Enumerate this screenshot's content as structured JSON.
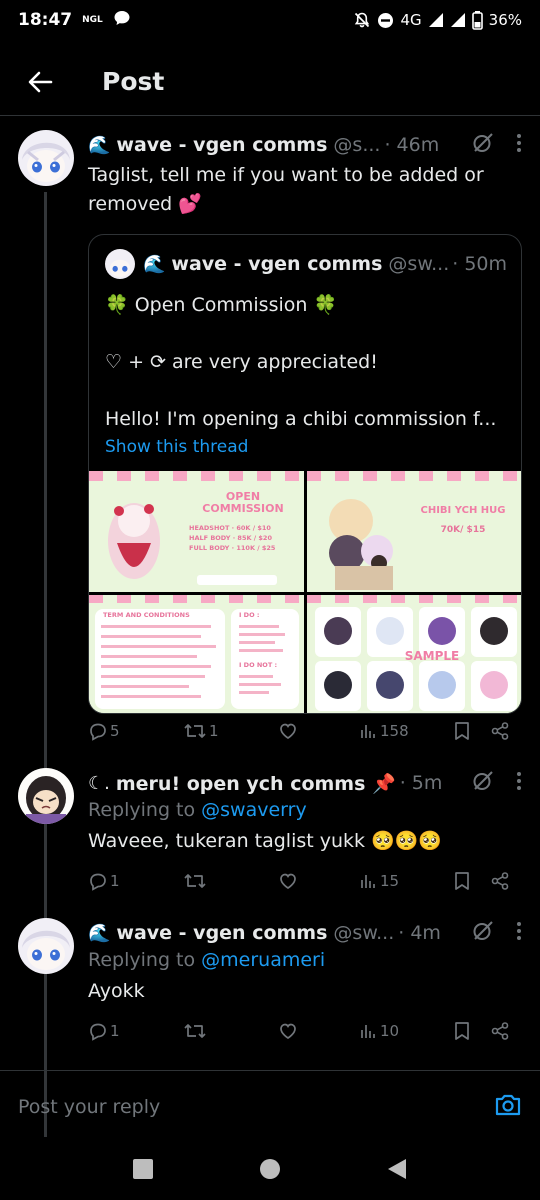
{
  "status": {
    "time": "18:47",
    "carrier_badge": "NGL",
    "network": "4G",
    "battery": "36%"
  },
  "header": {
    "title": "Post"
  },
  "main_tweet": {
    "name": "wave - vgen comms",
    "handle": "@s...",
    "time": "· 46m",
    "text": "Taglist, tell me if you want to be added or removed 💕",
    "quote": {
      "name": "wave - vgen comms",
      "handle": "@sw...",
      "time": "· 50m",
      "line1": "🍀 Open Commission 🍀",
      "line2": "♡ + ⟳ are very appreciated!",
      "line3": "Hello! I'm opening a chibi commission f...",
      "show_thread": "Show this thread",
      "images": {
        "img1_title": "OPEN COMMISSION",
        "img1_prices": [
          "HEADSHOT · 60K / $10",
          "HALF BODY · 85K / $20",
          "FULL BODY · 110K / $25"
        ],
        "img2_title": "CHIBI YCH HUG",
        "img2_price": "70K/ $15",
        "img3_title": "TERM AND CONDITIONS",
        "img3_do": "I DO :",
        "img3_dont": "I DO NOT :",
        "img4_label": "SAMPLE"
      }
    },
    "stats": {
      "replies": "5",
      "reposts": "1",
      "likes": "",
      "views": "158"
    }
  },
  "reply1": {
    "name": "meru! open ych comms 📌",
    "time": "· 5m",
    "replying_prefix": "Replying to ",
    "replying_mention": "@swaverry",
    "text": "Waveee, tukeran taglist yukk 🥺🥺🥺",
    "stats": {
      "replies": "1",
      "reposts": "",
      "likes": "",
      "views": "15"
    }
  },
  "reply2": {
    "name": "wave - vgen comms",
    "handle": "@sw...",
    "time": "· 4m",
    "replying_prefix": "Replying to ",
    "replying_mention": "@meruameri",
    "text": "Ayokk",
    "stats": {
      "replies": "1",
      "reposts": "",
      "likes": "",
      "views": "10"
    }
  },
  "reply_box": {
    "placeholder": "Post your reply"
  },
  "colors": {
    "accent": "#1d9bf0",
    "muted": "#71767b",
    "text": "#e7e9ea",
    "background": "#000000",
    "like_pink": "#f91880"
  }
}
